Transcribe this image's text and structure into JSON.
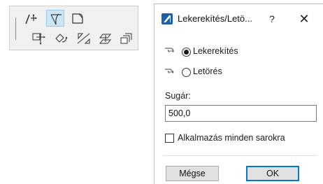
{
  "dialog": {
    "title": "Lekerekítés/Letö...",
    "help_label": "?",
    "close_label": "✕",
    "options": [
      {
        "label": "Lekerekítés",
        "checked": true,
        "icon": "fillet-icon"
      },
      {
        "label": "Letörés",
        "checked": false,
        "icon": "chamfer-icon"
      }
    ],
    "radius_label": "Sugár:",
    "radius_value": "500,0",
    "apply_all_label": "Alkalmazás minden sarokra",
    "apply_all_checked": false,
    "cancel_label": "Mégse",
    "ok_label": "OK"
  },
  "toolbar": {
    "tools": [
      {
        "name": "move-node-tool",
        "icon": "line-move-icon",
        "selected": false
      },
      {
        "name": "fillet-chamfer-tool",
        "icon": "corner-fillet-icon",
        "selected": true
      },
      {
        "name": "cut-corner-tool",
        "icon": "cut-corner-icon",
        "selected": false
      },
      {
        "name": "drag-tool",
        "icon": "drag-icon",
        "selected": false
      },
      {
        "name": "rotate-tool",
        "icon": "rotate-icon",
        "selected": false
      },
      {
        "name": "mirror-tool",
        "icon": "mirror-icon",
        "selected": false
      },
      {
        "name": "elevate-tool",
        "icon": "elevate-icon",
        "selected": false
      },
      {
        "name": "copy-tool",
        "icon": "copy-icon",
        "selected": false
      }
    ]
  },
  "colors": {
    "selection": "#cde6f7",
    "default_button_border": "#0078d7",
    "app_icon": "#1f5fa8"
  }
}
